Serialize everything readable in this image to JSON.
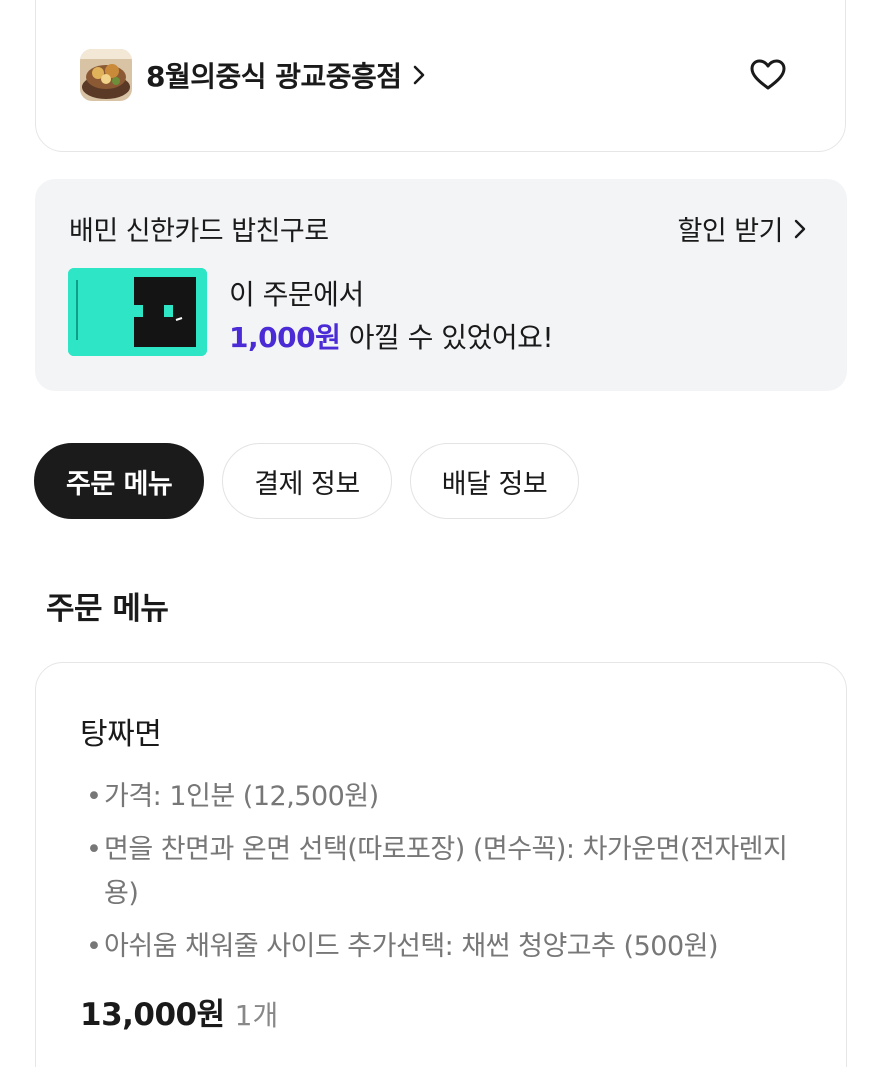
{
  "store": {
    "name": "8월의중식 광교중흥점",
    "thumbnail": "food-photo"
  },
  "promo": {
    "title": "배민 신한카드 밥친구로",
    "link_label": "할인 받기",
    "line1": "이 주문에서",
    "amount": "1,000원",
    "line2_suffix": " 아낄 수 있었어요!",
    "card_color": "#2ee6c6",
    "amount_color": "#4b2bd6"
  },
  "tabs": [
    {
      "label": "주문 메뉴",
      "active": true
    },
    {
      "label": "결제 정보",
      "active": false
    },
    {
      "label": "배달 정보",
      "active": false
    }
  ],
  "section": {
    "title": "주문 메뉴"
  },
  "order": {
    "item_name": "탕짜면",
    "options": [
      "가격: 1인분 (12,500원)",
      "면을 찬면과 온면 선택(따로포장) (면수꼭): 차가운면(전자렌지용)",
      "아쉬움 채워줄 사이드 추가선택: 채썬 청양고추 (500원)"
    ],
    "price": "13,000원",
    "quantity": "1개"
  }
}
